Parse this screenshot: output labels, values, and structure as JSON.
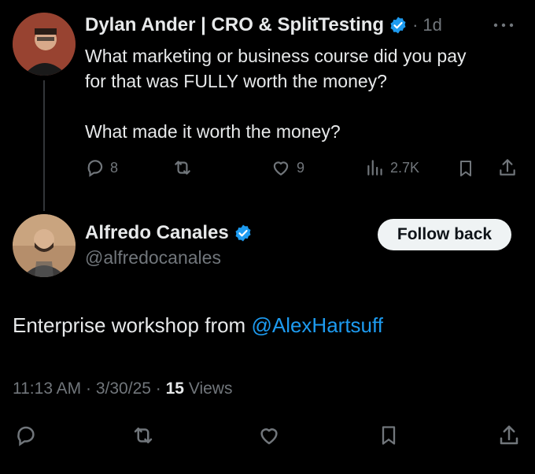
{
  "parent": {
    "author_name": "Dylan Ander | CRO & SplitTesting",
    "separator": "·",
    "time_ago": "1d",
    "more_icon": "more-horizontal-icon",
    "text_line1": "What marketing or business course did you pay",
    "text_line2": "for that was FULLY worth the money?",
    "text_line3": "What made it worth the money?",
    "metrics": {
      "replies": "8",
      "reposts": "",
      "likes": "9",
      "views": "2.7K"
    }
  },
  "reply": {
    "author_name": "Alfredo Canales",
    "handle": "@alfredocanales",
    "follow_label": "Follow back",
    "text_prefix": "Enterprise workshop from ",
    "mention": "@AlexHartsuff",
    "timestamp": "11:13 AM",
    "dot1": "·",
    "date": "3/30/25",
    "dot2": "·",
    "views_count": "15",
    "views_label": " Views"
  },
  "colors": {
    "background": "#000000",
    "text": "#e7e9ea",
    "muted": "#71767b",
    "link": "#1d9bf0",
    "verified": "#1d9bf0"
  }
}
